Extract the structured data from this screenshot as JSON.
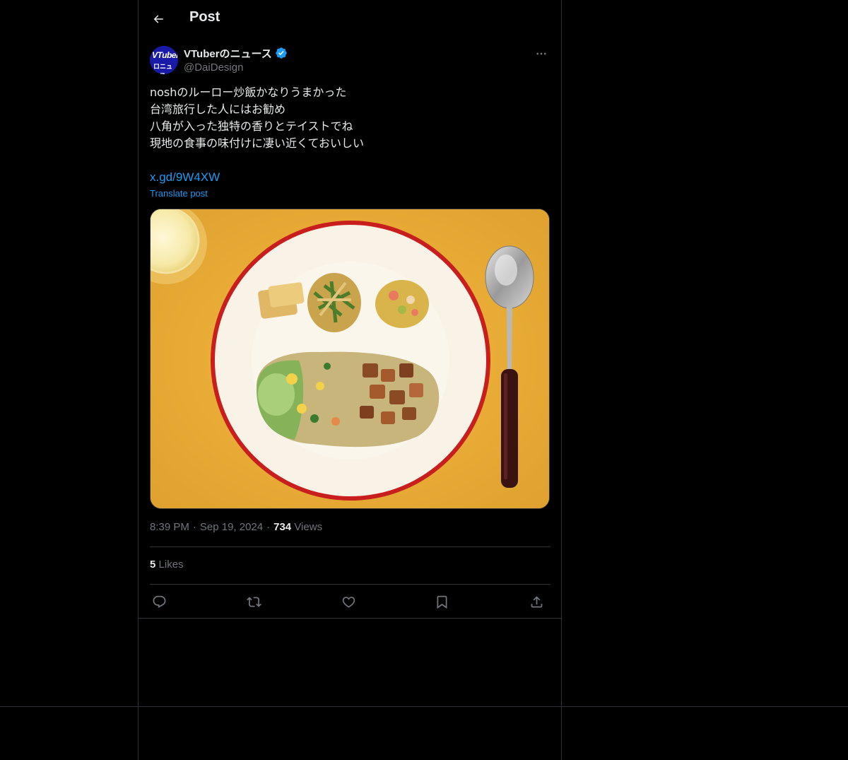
{
  "header": {
    "title": "Post"
  },
  "author": {
    "display_name": "VTuberのニュース",
    "handle": "@DaiDesign",
    "avatar_text_top": "VTuber",
    "avatar_text_bottom": "ロニュース",
    "verified": true
  },
  "post": {
    "lines": [
      "noshのルーロー炒飯かなりうまかった",
      "台湾旅行した人にはお勧め",
      "八角が入った独特の香りとテイストでね",
      "現地の食事の味付けに凄い近くておいしい"
    ],
    "link": "x.gd/9W4XW",
    "translate_label": "Translate post"
  },
  "meta": {
    "time": "8:39 PM",
    "date": "Sep 19, 2024",
    "views_count": "734",
    "views_label": "Views"
  },
  "engagement": {
    "likes_count": "5",
    "likes_label": "Likes"
  },
  "icons": {
    "back": "arrow-left-icon",
    "more": "more-horizontal-icon",
    "verified": "verified-badge-icon",
    "reply": "reply-icon",
    "repost": "repost-icon",
    "like": "heart-icon",
    "bookmark": "bookmark-icon",
    "share": "share-icon"
  },
  "colors": {
    "background": "#000000",
    "text": "#e7e9ea",
    "muted": "#71767b",
    "accent": "#1d9bf0",
    "border": "#2f3336"
  }
}
